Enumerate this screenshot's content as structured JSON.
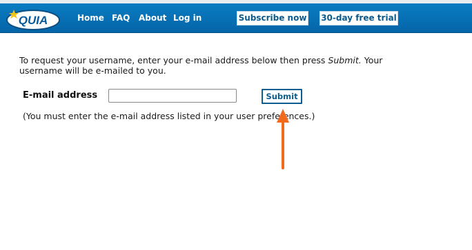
{
  "header": {
    "logo_text": "QUIA",
    "nav": [
      {
        "label": "Home"
      },
      {
        "label": "FAQ"
      },
      {
        "label": "About"
      },
      {
        "label": "Log in"
      }
    ],
    "subscribe_label": "Subscribe now",
    "trial_label": "30-day free trial"
  },
  "form": {
    "intro_part1": "To request your username, enter your e-mail address below then press ",
    "intro_submit_word": "Submit.",
    "intro_part2": " Your username will be e-mailed to you.",
    "email_label": "E-mail address",
    "email_value": "",
    "submit_label": "Submit",
    "note": "(You must enter the e-mail address listed in your user preferences.)"
  },
  "colors": {
    "header_blue": "#0565a8",
    "button_text": "#0c5e8f",
    "annotation_arrow": "#f26b1d"
  }
}
